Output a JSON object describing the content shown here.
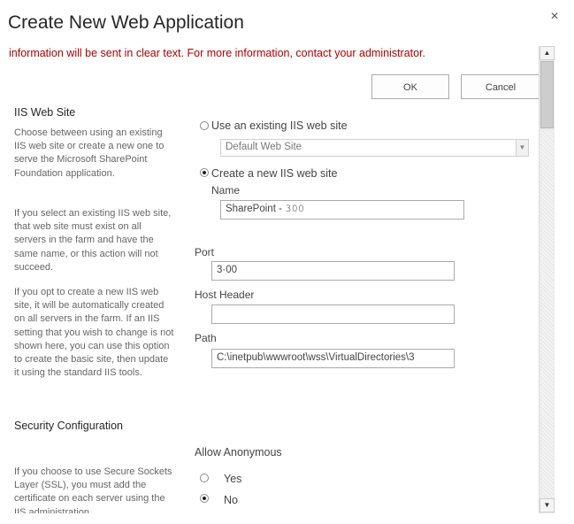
{
  "dialog": {
    "title": "Create New Web Application",
    "close_icon": "×"
  },
  "warning_text": "information will be sent in clear text. For more information, contact your administrator.",
  "buttons": {
    "ok_label": "OK",
    "cancel_label": "Cancel"
  },
  "iis_section": {
    "title": "IIS Web Site",
    "desc1": "Choose between using an existing IIS web site or create a new one to serve the Microsoft SharePoint Foundation application.",
    "desc2": "If you select an existing IIS web site, that web site must exist on all servers in the farm and have the same name, or this action will not succeed.",
    "desc3": "If you opt to create a new IIS web site, it will be automatically created on all servers in the farm. If an IIS setting that you wish to change is not shown here, you can use this option to create the basic site, then update it using the standard IIS tools.",
    "use_existing_label": "Use an existing IIS web site",
    "existing_site_selected": "Default Web Site",
    "create_new_label": "Create a new IIS web site",
    "name_label": "Name",
    "name_value": "SharePoint - 𝟹𝟶𝟶 ",
    "port_label": "Port",
    "port_value": "3·00",
    "host_header_label": "Host Header",
    "host_header_value": "",
    "path_label": "Path",
    "path_value": "C:\\inetpub\\wwwroot\\wss\\VirtualDirectories\\3"
  },
  "security_section": {
    "title": "Security Configuration",
    "desc": "If you choose to use Secure Sockets Layer (SSL), you must add the certificate on each server using the IIS administration",
    "allow_anonymous_label": "Allow Anonymous",
    "yes_label": "Yes",
    "no_label": "No"
  },
  "colors": {
    "warning": "#b00000",
    "title": "#262626"
  }
}
